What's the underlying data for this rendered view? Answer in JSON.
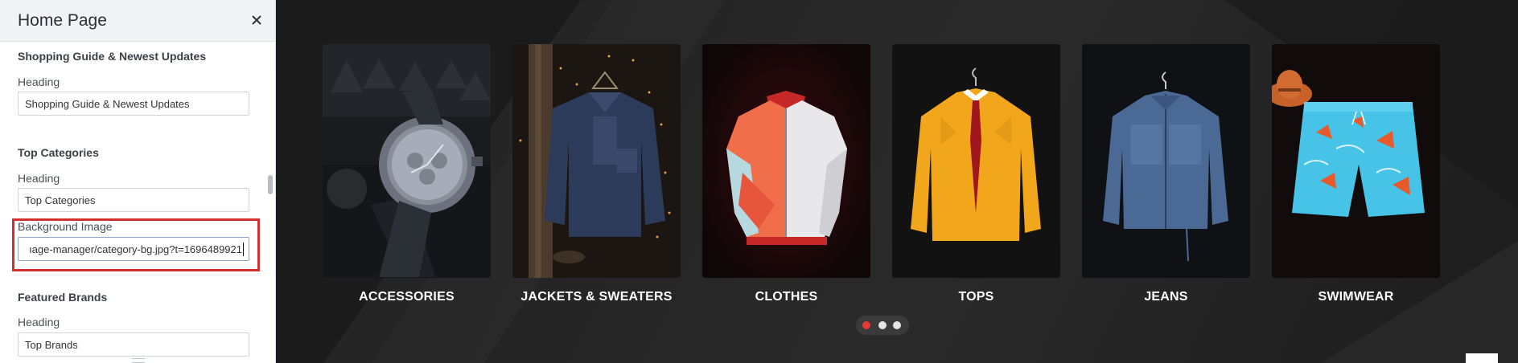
{
  "panel": {
    "title": "Home Page",
    "sections": [
      {
        "title": "Shopping Guide & Newest Updates",
        "heading_label": "Heading",
        "heading_value": "Shopping Guide & Newest Updates"
      },
      {
        "title": "Top Categories",
        "heading_label": "Heading",
        "heading_value": "Top Categories",
        "bg_label": "Background Image",
        "bg_value": "ıage-manager/category-bg.jpg?t=1696489921"
      },
      {
        "title": "Featured Brands",
        "heading_label": "Heading",
        "heading_value": "Top Brands"
      }
    ]
  },
  "preview": {
    "categories": [
      {
        "label": "ACCESSORIES",
        "image": "watch-image"
      },
      {
        "label": "JACKETS & SWEATERS",
        "image": "sweater-image"
      },
      {
        "label": "CLOTHES",
        "image": "jacket-image"
      },
      {
        "label": "TOPS",
        "image": "shirt-image"
      },
      {
        "label": "JEANS",
        "image": "denim-jacket-image"
      },
      {
        "label": "SWIMWEAR",
        "image": "swim-shorts-image"
      }
    ],
    "pagination": {
      "total": 3,
      "active": 1
    },
    "colors": {
      "accent": "#d32f2f",
      "dot_active": "#e53935",
      "dot_inactive": "#e6e6e6",
      "background": "#232323"
    }
  }
}
